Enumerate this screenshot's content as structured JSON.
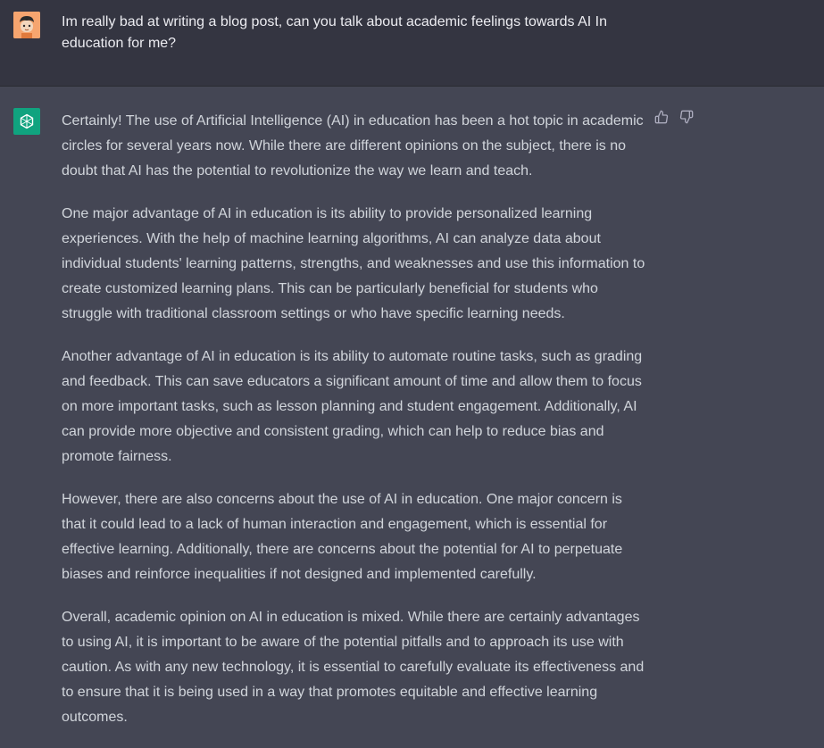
{
  "user_message": {
    "avatar_icon": "user-avatar-icon",
    "text": "Im really bad at writing a blog post, can you talk about academic feelings towards AI In education for me?"
  },
  "assistant_message": {
    "avatar_icon": "openai-logo-icon",
    "avatar_color": "#10a37f",
    "paragraphs": [
      "Certainly! The use of Artificial Intelligence (AI) in education has been a hot topic in academic circles for several years now. While there are different opinions on the subject, there is no doubt that AI has the potential to revolutionize the way we learn and teach.",
      "One major advantage of AI in education is its ability to provide personalized learning experiences. With the help of machine learning algorithms, AI can analyze data about individual students' learning patterns, strengths, and weaknesses and use this information to create customized learning plans. This can be particularly beneficial for students who struggle with traditional classroom settings or who have specific learning needs.",
      "Another advantage of AI in education is its ability to automate routine tasks, such as grading and feedback. This can save educators a significant amount of time and allow them to focus on more important tasks, such as lesson planning and student engagement. Additionally, AI can provide more objective and consistent grading, which can help to reduce bias and promote fairness.",
      "However, there are also concerns about the use of AI in education. One major concern is that it could lead to a lack of human interaction and engagement, which is essential for effective learning. Additionally, there are concerns about the potential for AI to perpetuate biases and reinforce inequalities if not designed and implemented carefully.",
      "Overall, academic opinion on AI in education is mixed. While there are certainly advantages to using AI, it is important to be aware of the potential pitfalls and to approach its use with caution. As with any new technology, it is essential to carefully evaluate its effectiveness and to ensure that it is being used in a way that promotes equitable and effective learning outcomes."
    ],
    "feedback_icons": [
      "thumbs-up-icon",
      "thumbs-down-icon"
    ]
  },
  "colors": {
    "user_bg": "#343541",
    "assistant_bg": "#444654",
    "text": "#d1d5db",
    "accent": "#10a37f"
  }
}
